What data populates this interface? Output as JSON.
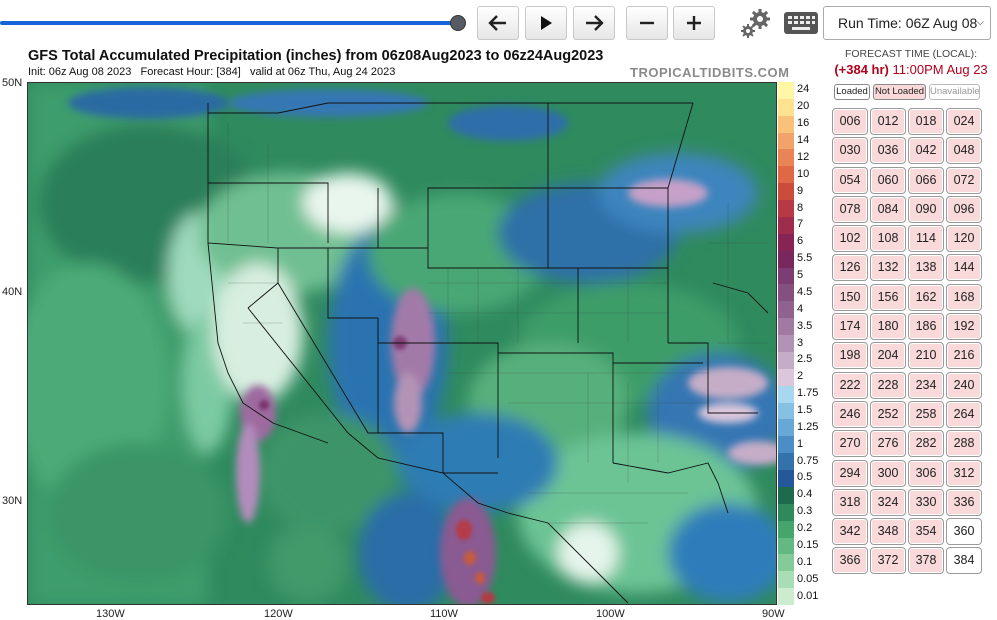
{
  "toolbar": {
    "buttons": [
      {
        "name": "prev-button",
        "icon": "arrow-left-icon"
      },
      {
        "name": "play-button",
        "icon": "play-icon"
      },
      {
        "name": "next-button",
        "icon": "arrow-right-icon"
      },
      {
        "name": "zoom-out-button",
        "icon": "minus-icon"
      },
      {
        "name": "zoom-in-button",
        "icon": "plus-icon"
      }
    ],
    "run_time": "Run Time: 06Z Aug 08",
    "settings_icon": "gear-icon",
    "keyboard_icon": "keyboard-icon"
  },
  "map": {
    "title": "GFS Total Accumulated Precipitation (inches) from 06z08Aug2023 to 06z24Aug2023",
    "subtitle": "Init: 06z Aug 08 2023   Forecast Hour: [384]   valid at 06z Thu, Aug 24 2023",
    "brand": "TROPICALTIDBITS.COM",
    "lat_labels": [
      "50N",
      "40N",
      "30N"
    ],
    "lon_labels": [
      "130W",
      "120W",
      "110W",
      "100W",
      "90W"
    ]
  },
  "colorbar": {
    "levels": [
      "24",
      "20",
      "16",
      "14",
      "12",
      "10",
      "9",
      "8",
      "7",
      "6",
      "5.5",
      "5",
      "4.5",
      "4",
      "3.5",
      "3",
      "2.5",
      "2",
      "1.75",
      "1.5",
      "1.25",
      "1",
      "0.75",
      "0.5",
      "0.4",
      "0.3",
      "0.2",
      "0.15",
      "0.1",
      "0.05",
      "0.01"
    ],
    "colors": [
      "#fff7a6",
      "#fde28f",
      "#f8c27a",
      "#f2a36a",
      "#e98457",
      "#df6846",
      "#cc4c3c",
      "#b53a45",
      "#9e2c4c",
      "#862553",
      "#78285f",
      "#7c3c74",
      "#83507f",
      "#8f6290",
      "#a07aa2",
      "#b393b5",
      "#c6adc7",
      "#dcc6dc",
      "#a8d8ef",
      "#86c1e4",
      "#67a8d6",
      "#4b8dc4",
      "#3472ac",
      "#24589a",
      "#1e6a4e",
      "#2e8a5a",
      "#46a56c",
      "#64b982",
      "#85cb9a",
      "#a8ddb5",
      "#cdeccf"
    ]
  },
  "forecast_panel": {
    "title": "FORECAST TIME (LOCAL):",
    "hour_offset": "(+384 hr)",
    "time": "11:00PM Aug 23",
    "legend": {
      "loaded": "Loaded",
      "not_loaded": "Not Loaded",
      "unavailable": "Unavailable"
    },
    "hours": [
      "006",
      "012",
      "018",
      "024",
      "030",
      "036",
      "042",
      "048",
      "054",
      "060",
      "066",
      "072",
      "078",
      "084",
      "090",
      "096",
      "102",
      "108",
      "114",
      "120",
      "126",
      "132",
      "138",
      "144",
      "150",
      "156",
      "162",
      "168",
      "174",
      "180",
      "186",
      "192",
      "198",
      "204",
      "210",
      "216",
      "222",
      "228",
      "234",
      "240",
      "246",
      "252",
      "258",
      "264",
      "270",
      "276",
      "282",
      "288",
      "294",
      "300",
      "306",
      "312",
      "318",
      "324",
      "330",
      "336",
      "342",
      "348",
      "354",
      "360",
      "366",
      "372",
      "378",
      "384"
    ],
    "loaded_hours": [
      "360",
      "384"
    ]
  },
  "colors": {
    "accent": "#1565d8",
    "not_loaded": "#f9d9d9",
    "loaded": "#ffffff",
    "highlight": "#b3001b"
  }
}
